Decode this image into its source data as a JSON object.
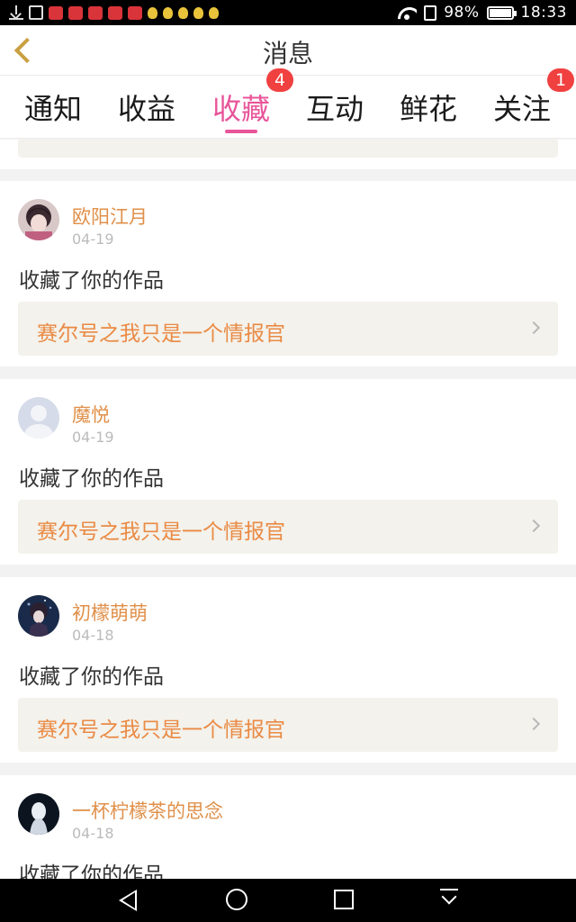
{
  "status_bar": {
    "battery": "98%",
    "time": "18:33"
  },
  "header": {
    "title": "消息"
  },
  "tabs": [
    {
      "label": "通知",
      "badge": ""
    },
    {
      "label": "收益",
      "badge": ""
    },
    {
      "label": "收藏",
      "badge": "4"
    },
    {
      "label": "互动",
      "badge": ""
    },
    {
      "label": "鲜花",
      "badge": ""
    },
    {
      "label": "关注",
      "badge": "1"
    }
  ],
  "active_tab": "收藏",
  "colors": {
    "accent": "#e8559a",
    "username": "#e0904a",
    "work_title": "#ea8a44",
    "badge": "#f04040"
  },
  "messages": [
    {
      "user": "欧阳江月",
      "date": "04-19",
      "action": "收藏了你的作品",
      "work": "赛尔号之我只是一个情报官",
      "avatar": "anime-girl-avatar"
    },
    {
      "user": "魔悦",
      "date": "04-19",
      "action": "收藏了你的作品",
      "work": "赛尔号之我只是一个情报官",
      "avatar": "default-user-avatar"
    },
    {
      "user": "初檬萌萌",
      "date": "04-18",
      "action": "收藏了你的作品",
      "work": "赛尔号之我只是一个情报官",
      "avatar": "dark-anime-avatar"
    },
    {
      "user": "一杯柠檬茶的思念",
      "date": "04-18",
      "action": "收藏了你的作品",
      "work": "",
      "avatar": "white-figure-avatar"
    }
  ]
}
